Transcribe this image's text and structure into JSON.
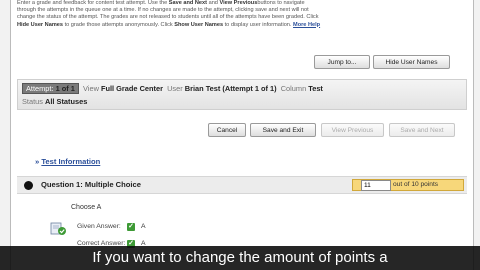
{
  "intro": {
    "line1": "Enter a grade and feedback for content test attempt. Use the",
    "b1": "Save and Next",
    "and": "and",
    "b2": "View Previous",
    "line1b": "buttons to navigate",
    "line2": "through the attempts in the queue one at a time. If no changes are made to the attempt, clicking save and next will not",
    "line3": "change the status of the attempt. The grades are not released to students until all of the attempts have been graded. Click",
    "b3": "Hide User Names",
    "line4a": "to grade those attempts anonymously. Click",
    "b4": "Show User Names",
    "line4b": "to display user information.",
    "more_help": "More Help"
  },
  "toolbar": {
    "jump_label": "Jump to...",
    "hide_names_label": "Hide User Names"
  },
  "infobar": {
    "attempt_label": "Attempt:",
    "attempt_value": "1 of 1",
    "view_label": "View",
    "view_value": "Full Grade Center",
    "user_label": "User",
    "user_value": "Brian Test (Attempt 1 of 1)",
    "column_label": "Column",
    "column_value": "Test",
    "status_label": "Status",
    "status_value": "All Statuses"
  },
  "actions": {
    "cancel": "Cancel",
    "save_exit": "Save and Exit",
    "view_previous": "View Previous",
    "save_next": "Save and Next"
  },
  "test_info": {
    "toggle": "»",
    "label": "Test Information"
  },
  "question": {
    "title": "Question 1:   Multiple Choice",
    "points_value": "11",
    "points_label": "out of 10 points",
    "prompt": "Choose A",
    "given_label": "Given Answer:",
    "given_value": "A",
    "correct_label": "Correct Answer:",
    "correct_value": "A"
  },
  "caption": {
    "text": "If you want to change the amount of points a"
  },
  "colors": {
    "link": "#2b4f9a",
    "points_highlight": "#f7d77a",
    "check_green": "#3e9a36"
  }
}
